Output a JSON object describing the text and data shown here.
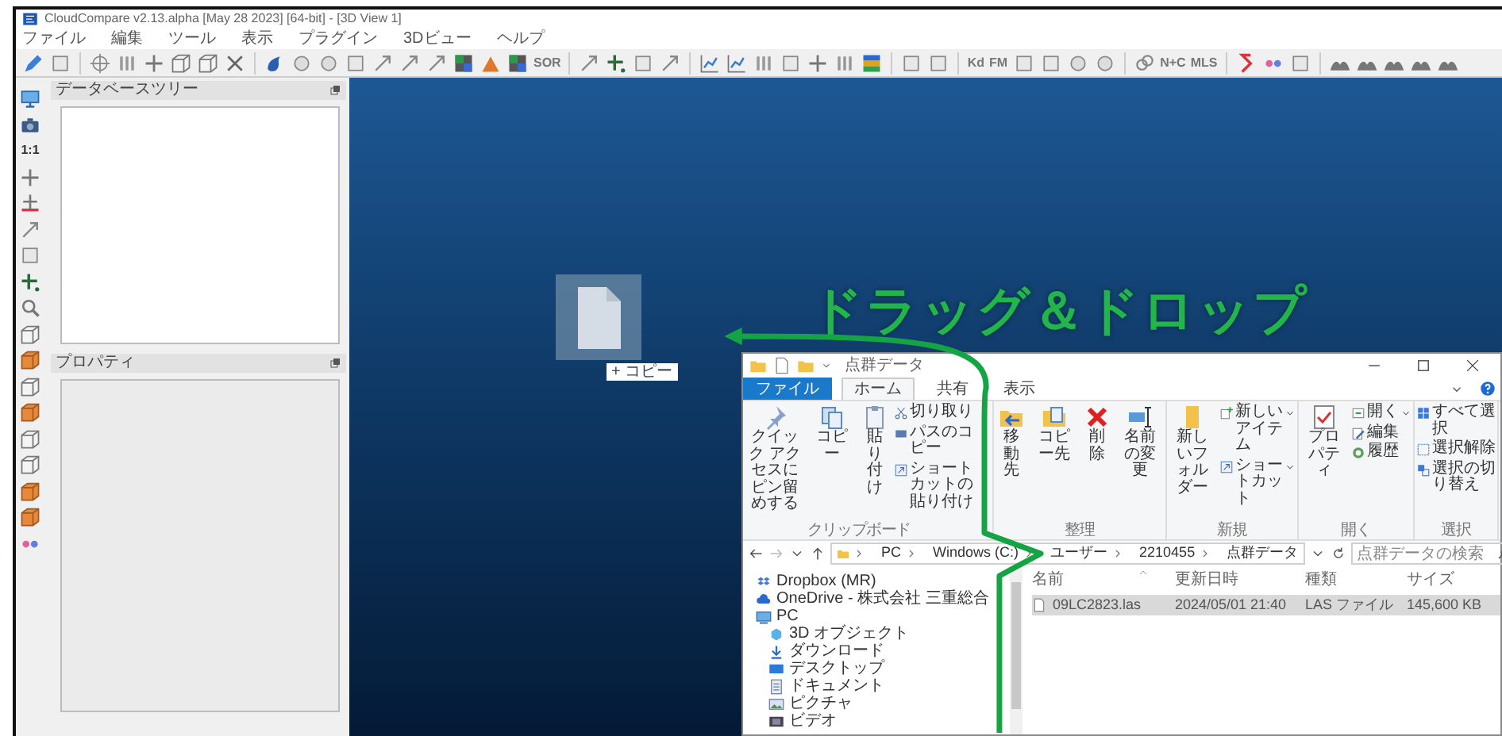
{
  "app": {
    "title": "CloudCompare v2.13.alpha [May 28 2023] [64-bit] - [3D View 1]",
    "menu": [
      "ファイル",
      "編集",
      "ツール",
      "表示",
      "プラグイン",
      "3Dビュー",
      "ヘルプ"
    ],
    "toolbar_labels": [
      "SOR",
      "Kd",
      "FM",
      "N+C",
      "MLS"
    ],
    "side_labels": [
      "1:1"
    ],
    "db_tree": {
      "title": "データベースツリー"
    },
    "properties": {
      "title": "プロパティ"
    }
  },
  "view": {
    "headline": "ドラッグ＆ドロップ",
    "drag_badge": "+ コピー"
  },
  "explorer": {
    "title": "点群データ",
    "tabs": [
      {
        "label": "ファイル",
        "kind": "file",
        "selected": false
      },
      {
        "label": "ホーム",
        "kind": "tab",
        "selected": true
      },
      {
        "label": "共有",
        "kind": "tab",
        "selected": false
      },
      {
        "label": "表示",
        "kind": "tab",
        "selected": false
      }
    ],
    "ribbon": [
      {
        "label": "クリップボード",
        "large": [
          "クイック アクセスにピン留めする",
          "コピー",
          "貼り付け"
        ],
        "small": [
          {
            "label": "切り取り",
            "dropdown": false
          },
          {
            "label": "パスのコピー",
            "dropdown": false
          },
          {
            "label": "ショートカットの貼り付け",
            "dropdown": false
          }
        ]
      },
      {
        "label": "整理",
        "large": [
          "移動先",
          "コピー先",
          "削除",
          "名前の変更"
        ]
      },
      {
        "label": "新規",
        "large": [
          "新しいフォルダー"
        ],
        "small": [
          {
            "label": "新しいアイテム",
            "dropdown": true
          },
          {
            "label": "ショートカット",
            "dropdown": true
          }
        ]
      },
      {
        "label": "開く",
        "large": [
          "プロパティ"
        ],
        "small": [
          {
            "label": "開く",
            "dropdown": true
          },
          {
            "label": "編集",
            "dropdown": false
          },
          {
            "label": "履歴",
            "dropdown": false
          }
        ]
      },
      {
        "label": "選択",
        "small": [
          {
            "label": "すべて選択",
            "dropdown": false
          },
          {
            "label": "選択解除",
            "dropdown": false
          },
          {
            "label": "選択の切り替え",
            "dropdown": false
          }
        ]
      }
    ],
    "path": [
      "PC",
      "Windows (C:)",
      "ユーザー",
      "2210455",
      "点群データ"
    ],
    "search": {
      "placeholder": "点群データの検索"
    },
    "nav": [
      {
        "label": "Dropbox (MR)"
      },
      {
        "label": "OneDrive - 株式会社 三重総合"
      },
      {
        "label": "PC",
        "children": [
          {
            "label": "3D オブジェクト"
          },
          {
            "label": "ダウンロード"
          },
          {
            "label": "デスクトップ"
          },
          {
            "label": "ドキュメント"
          },
          {
            "label": "ピクチャ"
          },
          {
            "label": "ビデオ"
          }
        ]
      }
    ],
    "columns": [
      "名前",
      "更新日時",
      "種類",
      "サイズ"
    ],
    "rows": [
      {
        "cells": [
          "09LC2823.las",
          "2024/05/01 21:40",
          "LAS ファイル",
          "145,600 KB"
        ],
        "selected": true
      }
    ]
  }
}
